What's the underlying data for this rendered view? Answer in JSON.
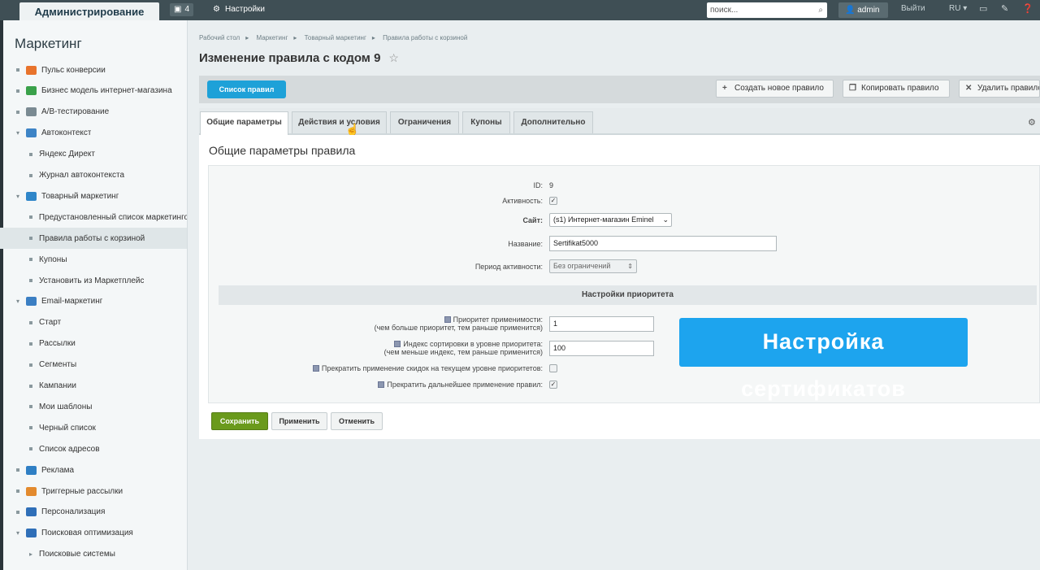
{
  "topbar": {
    "brand": "Администрирование",
    "notifications_count": "4",
    "settings_label": "Настройки",
    "search_placeholder": "поиск...",
    "user": "admin",
    "logout": "Выйти",
    "lang": "RU"
  },
  "sidebar": {
    "title": "Маркетинг",
    "items": [
      {
        "label": "Пульс конверсии",
        "level": 1,
        "icon_color": "#e8732c"
      },
      {
        "label": "Бизнес модель интернет-магазина",
        "level": 1,
        "icon_color": "#3aa14a"
      },
      {
        "label": "A/B-тестирование",
        "level": 1,
        "icon_color": "#7a8a92"
      },
      {
        "label": "Автоконтекст",
        "level": 1,
        "expanded": true,
        "icon_color": "#3d84c6"
      },
      {
        "label": "Яндекс Директ",
        "level": 2
      },
      {
        "label": "Журнал автоконтекста",
        "level": 2
      },
      {
        "label": "Товарный маркетинг",
        "level": 1,
        "expanded": true,
        "icon_color": "#2f86c9"
      },
      {
        "label": "Предустановленный список маркетингов",
        "level": 2
      },
      {
        "label": "Правила работы с корзиной",
        "level": 2,
        "active": true
      },
      {
        "label": "Купоны",
        "level": 2
      },
      {
        "label": "Установить из Маркетплейс",
        "level": 2
      },
      {
        "label": "Email-маркетинг",
        "level": 1,
        "expanded": true,
        "icon_color": "#3b7fc3"
      },
      {
        "label": "Старт",
        "level": 2
      },
      {
        "label": "Рассылки",
        "level": 2
      },
      {
        "label": "Сегменты",
        "level": 2
      },
      {
        "label": "Кампании",
        "level": 2
      },
      {
        "label": "Мои шаблоны",
        "level": 2
      },
      {
        "label": "Черный список",
        "level": 2
      },
      {
        "label": "Список адресов",
        "level": 2
      },
      {
        "label": "Реклама",
        "level": 1,
        "icon_color": "#2f7fc4"
      },
      {
        "label": "Триггерные рассылки",
        "level": 1,
        "icon_color": "#e38a2e"
      },
      {
        "label": "Персонализация",
        "level": 1,
        "icon_color": "#2f6fb8"
      },
      {
        "label": "Поисковая оптимизация",
        "level": 1,
        "expanded": true,
        "icon_color": "#2f6fb8"
      },
      {
        "label": "Поисковые системы",
        "level": 2,
        "arrow": true
      }
    ]
  },
  "breadcrumb": [
    "Рабочий стол",
    "Маркетинг",
    "Товарный маркетинг",
    "Правила работы с корзиной"
  ],
  "page_title": "Изменение правила с кодом 9",
  "toolbar": {
    "list_button": "Список правил",
    "create_button": "Создать новое правило",
    "copy_button": "Копировать правило",
    "delete_button": "Удалить правило"
  },
  "tabs": [
    "Общие параметры",
    "Действия и условия",
    "Ограничения",
    "Купоны",
    "Дополнительно"
  ],
  "panel_title": "Общие параметры правила",
  "form": {
    "id_label": "ID:",
    "id_value": "9",
    "active_label": "Активность:",
    "active_checked": true,
    "site_label": "Сайт:",
    "site_value": "(s1) Интернет-магазин Eminel",
    "name_label": "Название:",
    "name_value": "Sertifikat5000",
    "period_label": "Период активности:",
    "period_value": "Без ограничений",
    "priority_section": "Настройки приоритета",
    "priority_label_1": "Приоритет применимости:",
    "priority_label_2": "(чем больше приоритет, тем раньше применится)",
    "priority_value": "1",
    "sort_label_1": "Индекс сортировки в уровне приоритета:",
    "sort_label_2": "(чем меньше индекс, тем раньше применится)",
    "sort_value": "100",
    "stop_level_label": "Прекратить применение скидок на текущем уровне приоритетов:",
    "stop_level_checked": false,
    "stop_further_label": "Прекратить дальнейшее применение правил:",
    "stop_further_checked": true
  },
  "buttons": {
    "save": "Сохранить",
    "apply": "Применить",
    "cancel": "Отменить"
  },
  "overlay_caption": "Настройка сертификатов"
}
